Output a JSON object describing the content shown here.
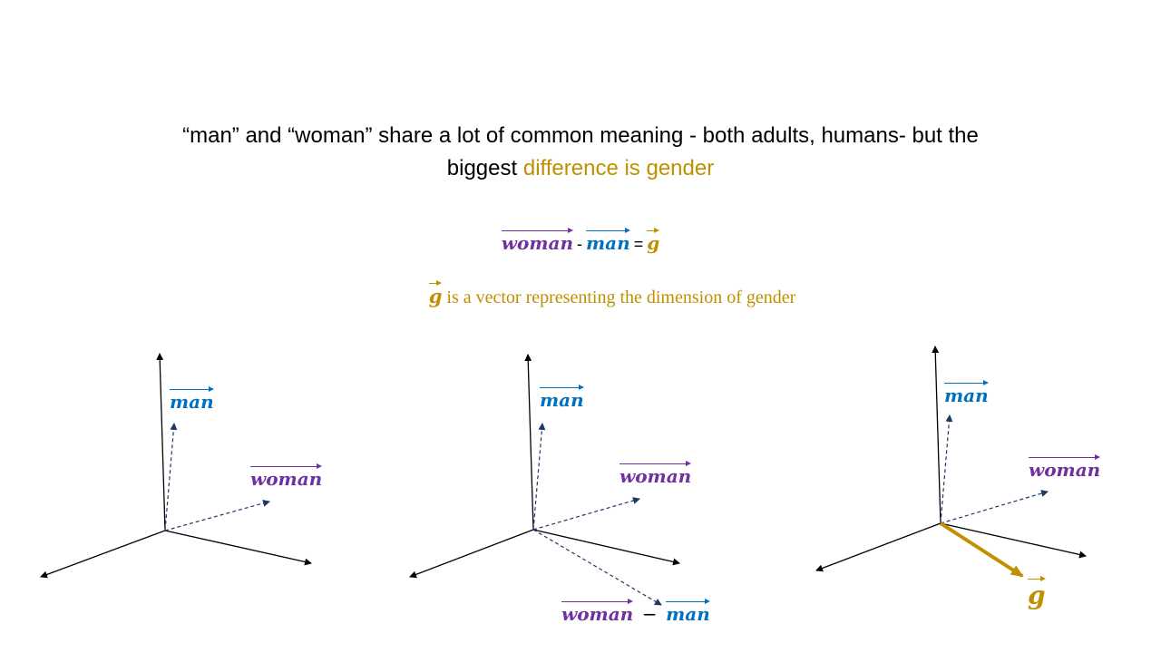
{
  "heading": {
    "line1": "“man” and “woman” share a lot of common meaning - both adults, humans- but the",
    "line2_prefix": "biggest ",
    "line2_highlight": "difference is gender"
  },
  "equation": {
    "term1": "woman",
    "minus": "-",
    "term2": "man",
    "equals": "=",
    "result": "g"
  },
  "g_description": {
    "symbol": "g",
    "text": " is a vector representing the dimension of gender"
  },
  "panels": [
    {
      "man_label": "man",
      "woman_label": "woman"
    },
    {
      "man_label": "man",
      "woman_label": "woman",
      "diff_woman": "woman",
      "diff_minus": "−",
      "diff_man": "man"
    },
    {
      "man_label": "man",
      "woman_label": "woman",
      "g_label": "g"
    }
  ],
  "colors": {
    "man": "#0070C0",
    "woman": "#7030A0",
    "gender": "#BF9000",
    "axes": "#000000",
    "dashed": "#1F3864"
  }
}
